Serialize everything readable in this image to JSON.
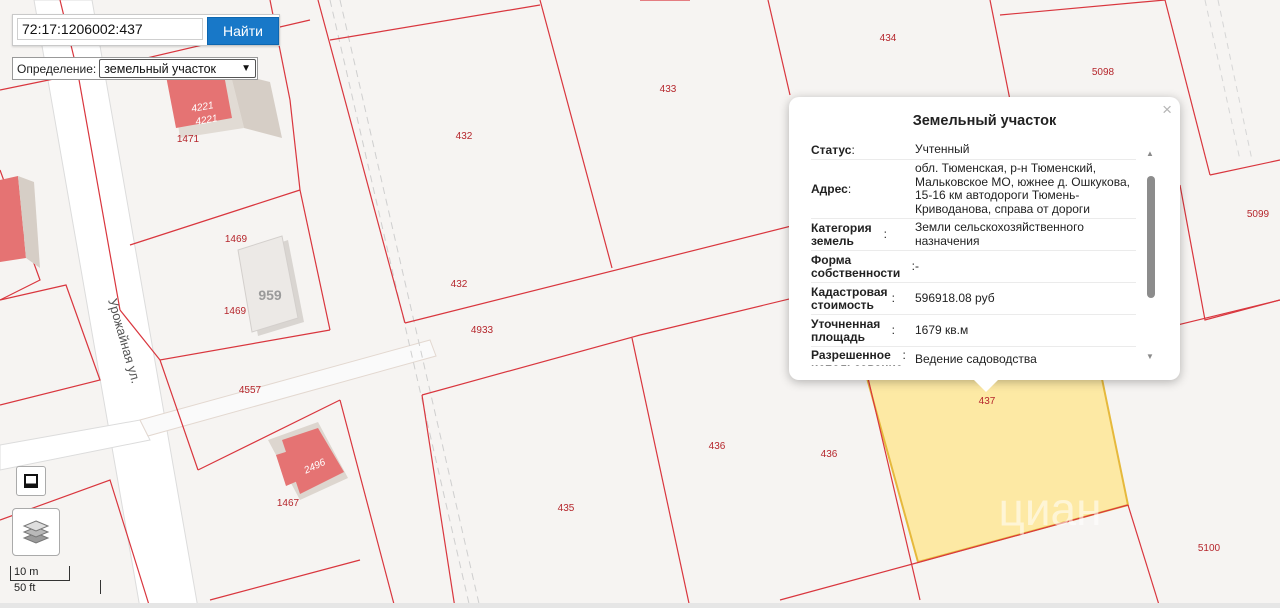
{
  "search": {
    "value": "72:17:1206002:437",
    "button_label": "Найти"
  },
  "definition": {
    "label": "Определение:",
    "selected": "земельный участок"
  },
  "popup": {
    "title": "Земельный участок",
    "close": "×",
    "rows": [
      {
        "label": "Статус",
        "value": "Учтенный"
      },
      {
        "label": "Адрес",
        "value": "обл. Тюменская, р-н Тюменский, Мальковское МО, южнее д. Ошкукова, 15-16 км автодороги Тюмень-Криводанова, справа от дороги"
      },
      {
        "label": "Категория земель",
        "value": "Земли сельскохозяйственного назначения"
      },
      {
        "label": "Форма собственности",
        "value": "-"
      },
      {
        "label": "Кадастровая стоимость",
        "value": "596918.08 руб"
      },
      {
        "label": "Уточненная площадь",
        "value": "1679 кв.м"
      },
      {
        "label": "Разрешенное использование",
        "value": "Ведение садоводства"
      }
    ]
  },
  "map": {
    "street_label": "Урожайная ул.",
    "parcel_labels": {
      "p434": "434",
      "p5098": "5098",
      "p433": "433",
      "p432a": "432",
      "p432b": "432",
      "p4933": "4933",
      "p5099": "5099",
      "p1471": "1471",
      "p1469a": "1469",
      "p1469b": "1469",
      "p4557": "4557",
      "p1467": "1467",
      "p436a": "436",
      "p436b": "436",
      "p435": "435",
      "p437": "437",
      "p5100": "5100"
    },
    "building_labels": {
      "b4221a": "4221",
      "b4221b": "4221",
      "b959": "959",
      "b2496": "2496"
    },
    "watermark": "циан",
    "highlight_color": "#fde9a4",
    "boundary_color": "#d9363e",
    "building_color": "#e57373"
  },
  "scale": {
    "metric": "10 m",
    "imperial": "50 ft"
  }
}
